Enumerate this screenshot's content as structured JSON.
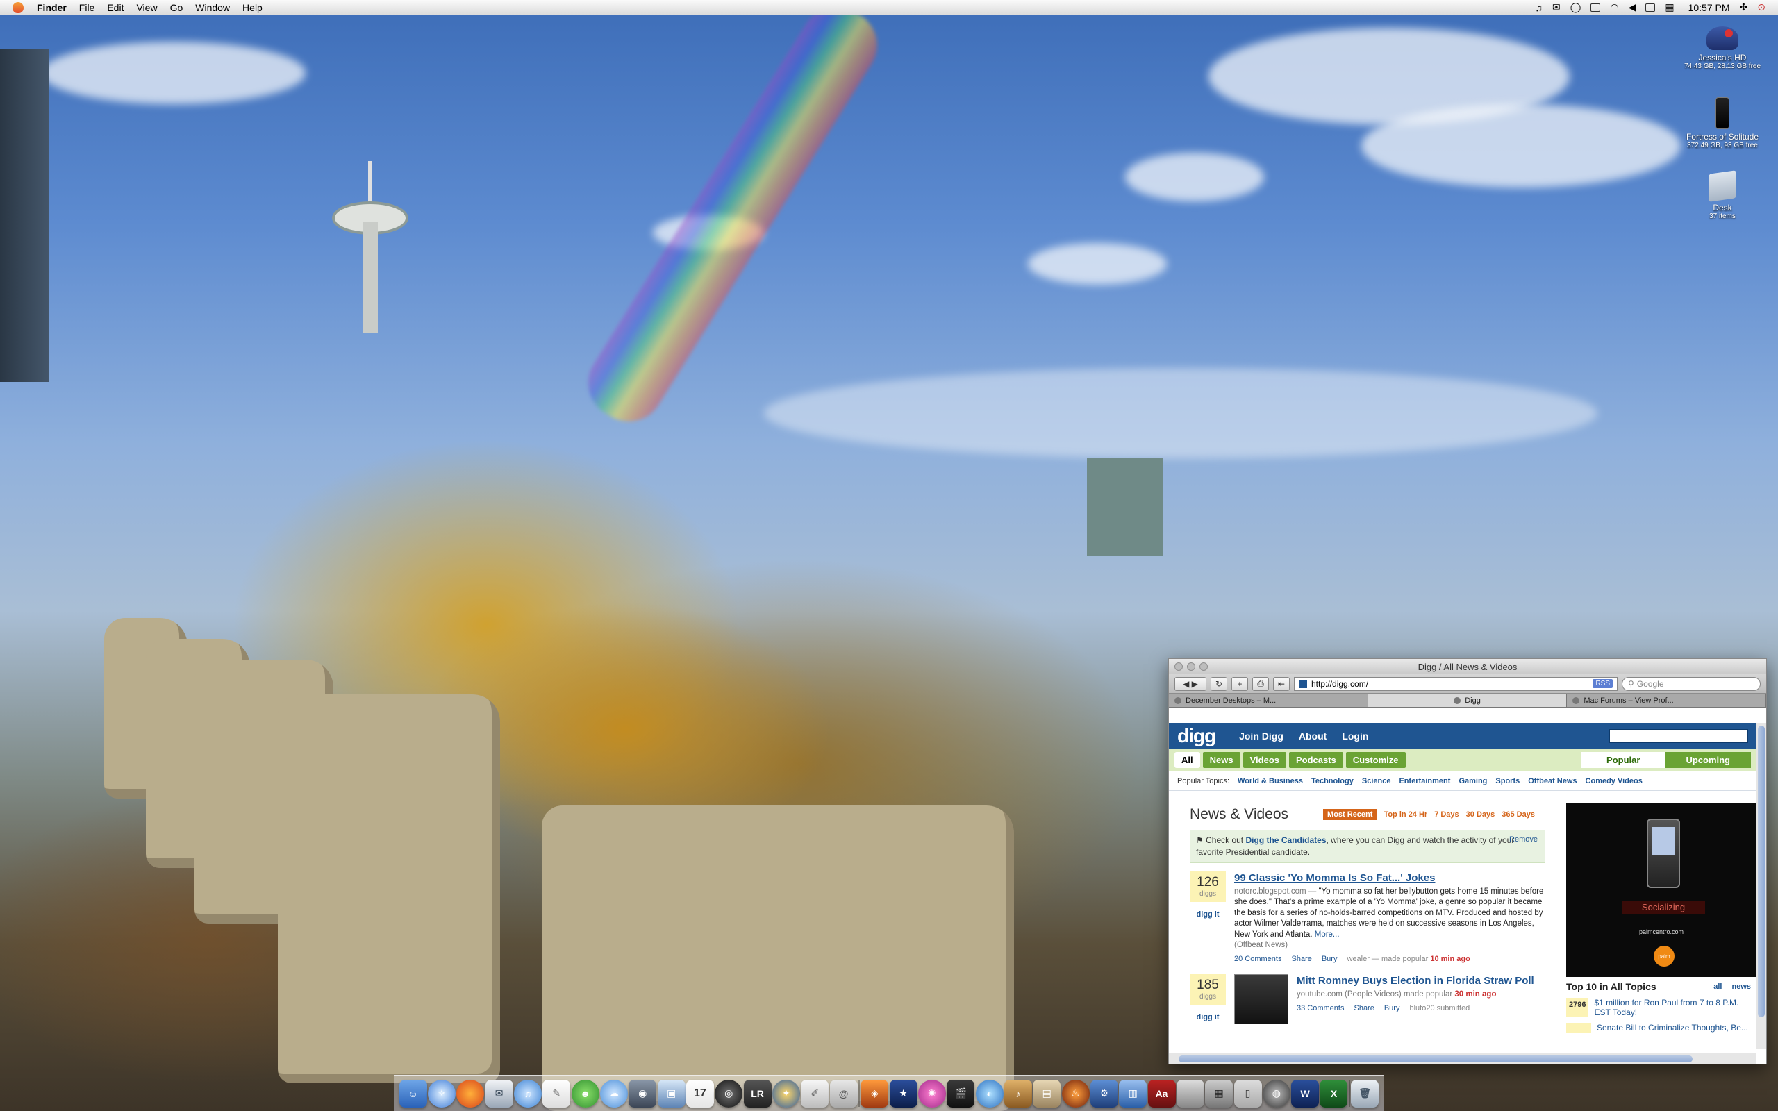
{
  "menubar": {
    "app_name": "Finder",
    "menus": [
      "File",
      "Edit",
      "View",
      "Go",
      "Window",
      "Help"
    ],
    "clock": "10:57 PM"
  },
  "desktop_icons": [
    {
      "name": "Jessica's HD",
      "detail": "74.43 GB, 28.13 GB free",
      "icon": "hard-drive-icon"
    },
    {
      "name": "Fortress of Solitude",
      "detail": "372.49 GB, 93 GB free",
      "icon": "external-drive-icon"
    },
    {
      "name": "Desk",
      "detail": "37 items",
      "icon": "folder-icon"
    }
  ],
  "browser": {
    "window_title": "Digg / All News & Videos",
    "url": "http://digg.com/",
    "rss_label": "RSS",
    "search_placeholder": "Google",
    "tabs": [
      {
        "label": "December Desktops – M..."
      },
      {
        "label": "Digg"
      },
      {
        "label": "Mac Forums – View Prof..."
      }
    ]
  },
  "digg": {
    "logo": "digg",
    "header_links": [
      "Join Digg",
      "About",
      "Login"
    ],
    "nav": {
      "all": "All",
      "items": [
        "News",
        "Videos",
        "Podcasts"
      ],
      "customize": "Customize",
      "popular": "Popular",
      "upcoming": "Upcoming"
    },
    "topics_label": "Popular Topics:",
    "topics": [
      "World & Business",
      "Technology",
      "Science",
      "Entertainment",
      "Gaming",
      "Sports",
      "Offbeat News",
      "Comedy Videos"
    ],
    "section_title": "News & Videos",
    "filters": {
      "active": "Most Recent",
      "others": [
        "Top in 24 Hr",
        "7 Days",
        "30 Days",
        "365 Days"
      ]
    },
    "notice": {
      "prefix": "Check out ",
      "link": "Digg the Candidates",
      "suffix": ", where you can Digg and watch the activity of your favorite Presidential candidate.",
      "remove": "Remove"
    },
    "stories": [
      {
        "diggs": "126",
        "diggs_label": "diggs",
        "digg_it": "digg it",
        "headline": "99 Classic 'Yo Momma Is So Fat...' Jokes",
        "source": "notorc.blogspot.com —",
        "summary": "\"Yo momma so fat her bellybutton gets home 15 minutes before she does.\" That's a prime example of a 'Yo Momma' joke, a genre so popular it became the basis for a series of no-holds-barred competitions on MTV. Produced and hosted by actor Wilmer Valderrama, matches were held on successive seasons in Los Angeles, New York and Atlanta.",
        "more": "More...",
        "category": "(Offbeat News)",
        "comments": "20 Comments",
        "share": "Share",
        "bury": "Bury",
        "user_meta": "wealer — made popular",
        "time": "10 min ago"
      },
      {
        "diggs": "185",
        "diggs_label": "diggs",
        "digg_it": "digg it",
        "headline": "Mitt Romney Buys Election in Florida Straw Poll",
        "source": "youtube.com (People Videos) made popular",
        "time": "30 min ago",
        "comments": "33 Comments",
        "share": "Share",
        "bury": "Bury",
        "user_meta": "bluto20 submitted"
      }
    ],
    "ad": {
      "tagline": "Socializing",
      "url": "palmcentro.com",
      "brand": "palm"
    },
    "top10": {
      "title": "Top 10 in All Topics",
      "links": [
        "all",
        "news"
      ],
      "items": [
        {
          "diggs": "2796",
          "title": "$1 million for Ron Paul from 7 to 8 P.M. EST Today!"
        },
        {
          "diggs": "",
          "title": "Senate Bill to Criminalize Thoughts, Be..."
        }
      ]
    }
  },
  "dock": {
    "items": [
      "finder",
      "safari",
      "firefox",
      "mail",
      "itunes",
      "textedit",
      "adium",
      "ichat",
      "photo-booth",
      "preview",
      "ical",
      "dvd-player",
      "lightroom",
      "mail-plus",
      "script-editor",
      "address-book",
      "coda",
      "photoshop",
      "imovie",
      "quicktime",
      "iphoto",
      "garageband",
      "dictionary",
      "system-prefs",
      "calculator",
      "terminal",
      "utility",
      "word",
      "excel",
      "trash"
    ],
    "lightroom_label": "LR",
    "calendar_day": "17"
  }
}
